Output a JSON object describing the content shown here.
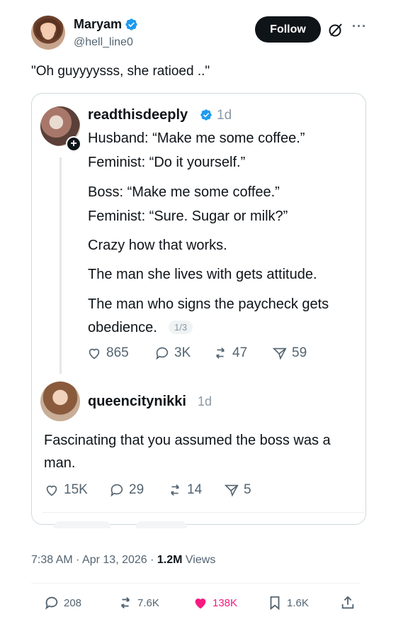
{
  "author": {
    "display_name": "Maryam",
    "handle": "@hell_line0",
    "follow_label": "Follow"
  },
  "tweet_text": "\"Oh guyyyysss, she ratioed ..\"",
  "quoted": {
    "name": "readthisdeeply",
    "time": "1d",
    "lines": [
      "Husband: “Make me some coffee.”",
      "Feminist: “Do it yourself.”",
      "Boss: “Make me some coffee.”",
      "Feminist: “Sure. Sugar or milk?”",
      "Crazy how that works.",
      "The man she lives with gets attitude.",
      "The man who signs the paycheck gets",
      "obedience."
    ],
    "page_indicator": "1/3",
    "metrics": {
      "likes": "865",
      "replies": "3K",
      "reposts": "47",
      "shares": "59"
    }
  },
  "reply": {
    "name": "queencitynikki",
    "time": "1d",
    "lines": [
      "Fascinating that you assumed the boss was a",
      "man."
    ],
    "metrics": {
      "likes": "15K",
      "replies": "29",
      "reposts": "14",
      "shares": "5"
    }
  },
  "meta": {
    "time": "7:38 AM",
    "date": "Apr 13, 2026",
    "views_count": "1.2M",
    "views_label": "Views"
  },
  "actions": {
    "replies": "208",
    "reposts": "7.6K",
    "likes": "138K",
    "bookmarks": "1.6K"
  },
  "colors": {
    "verified": "#1d9bf0",
    "like_active": "#f91880",
    "muted": "#536471",
    "text": "#0f1419"
  },
  "icons": [
    "verified-badge-icon",
    "grok-icon",
    "more-icon",
    "heart-icon",
    "reply-icon",
    "repost-icon",
    "share-icon",
    "bookmark-icon",
    "upload-icon",
    "plus-icon"
  ]
}
